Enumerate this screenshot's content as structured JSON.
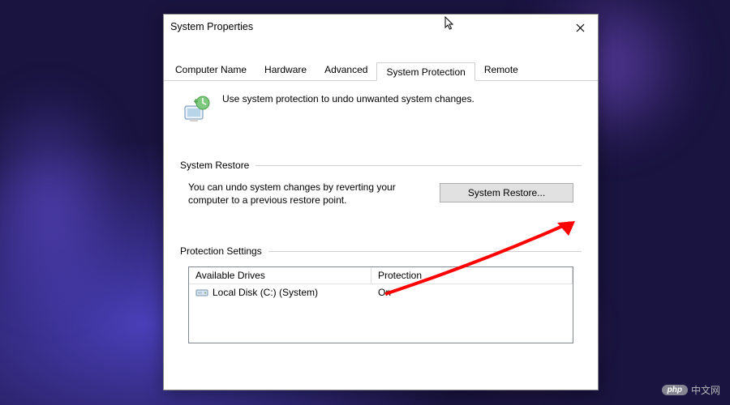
{
  "window": {
    "title": "System Properties"
  },
  "tabs": {
    "items": [
      {
        "label": "Computer Name"
      },
      {
        "label": "Hardware"
      },
      {
        "label": "Advanced"
      },
      {
        "label": "System Protection",
        "active": true
      },
      {
        "label": "Remote"
      }
    ]
  },
  "intro": {
    "text": "Use system protection to undo unwanted system changes."
  },
  "system_restore": {
    "header": "System Restore",
    "description": "You can undo system changes by reverting your computer to a previous restore point.",
    "button": "System Restore..."
  },
  "protection_settings": {
    "header": "Protection Settings",
    "table": {
      "headers": {
        "drives": "Available Drives",
        "protection": "Protection"
      },
      "rows": [
        {
          "drive": "Local Disk (C:) (System)",
          "protection": "On"
        }
      ]
    }
  },
  "watermark": {
    "badge": "php",
    "text": "中文网"
  }
}
